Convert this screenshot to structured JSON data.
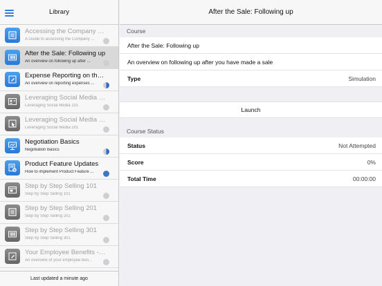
{
  "sidebar": {
    "title": "Library",
    "footer": "Last updated a minute ago",
    "items": [
      {
        "title": "Accessing the Company Be...",
        "subtitle": "A Guide to accessing the Company ...",
        "icon": "list-icon",
        "status": "not-attempted"
      },
      {
        "title": "After the Sale: Following up",
        "subtitle": "An overview on following up after ...",
        "icon": "barcode-icon",
        "status": "not-attempted"
      },
      {
        "title": "Expense Reporting on the ...",
        "subtitle": "An overview on reporting expenses ...",
        "icon": "pencil-icon",
        "status": "in-progress"
      },
      {
        "title": "Leveraging Social Media fo...",
        "subtitle": "Leveraging Social Media 101",
        "icon": "user-card-icon",
        "status": "not-attempted"
      },
      {
        "title": "Leveraging Social Media fo...",
        "subtitle": "Leveraging Social Media 201",
        "icon": "cursor-icon",
        "status": "not-attempted"
      },
      {
        "title": "Negotiation Basics",
        "subtitle": "Negotiation Basics",
        "icon": "presentation-icon",
        "status": "in-progress"
      },
      {
        "title": "Product Feature Updates",
        "subtitle": "How to implement Product Feature ...",
        "icon": "document-plus-icon",
        "status": "completed"
      },
      {
        "title": "Step by Step Selling 101",
        "subtitle": "Step by Step Selling 101",
        "icon": "window-icon",
        "status": "not-attempted"
      },
      {
        "title": "Step by Step Selling 201",
        "subtitle": "Step by Step Selling 201",
        "icon": "list-icon",
        "status": "not-attempted"
      },
      {
        "title": "Step by Step Selling 301",
        "subtitle": "Step by Step Selling 301",
        "icon": "barcode-icon",
        "status": "not-attempted"
      },
      {
        "title": "Your Employee Benefits - ...",
        "subtitle": "An overview of your employee ben...",
        "icon": "pencil-icon",
        "status": "not-attempted"
      }
    ]
  },
  "main": {
    "title": "After the Sale: Following up",
    "course_label": "Course",
    "course_name": "After the Sale: Following up",
    "course_description": "An overview on following up after you have made a sale",
    "type_label": "Type",
    "type_value": "Simulation",
    "launch_label": "Launch",
    "status_section_label": "Course Status",
    "status_label": "Status",
    "status_value": "Not Attempted",
    "score_label": "Score",
    "score_value": "0%",
    "total_time_label": "Total Time",
    "total_time_value": "00:00:00"
  },
  "colors": {
    "accent": "#2f7de1",
    "icon_blue": "#2b78d6",
    "icon_gray": "#666666",
    "selected_row": "#d9d9d9"
  }
}
